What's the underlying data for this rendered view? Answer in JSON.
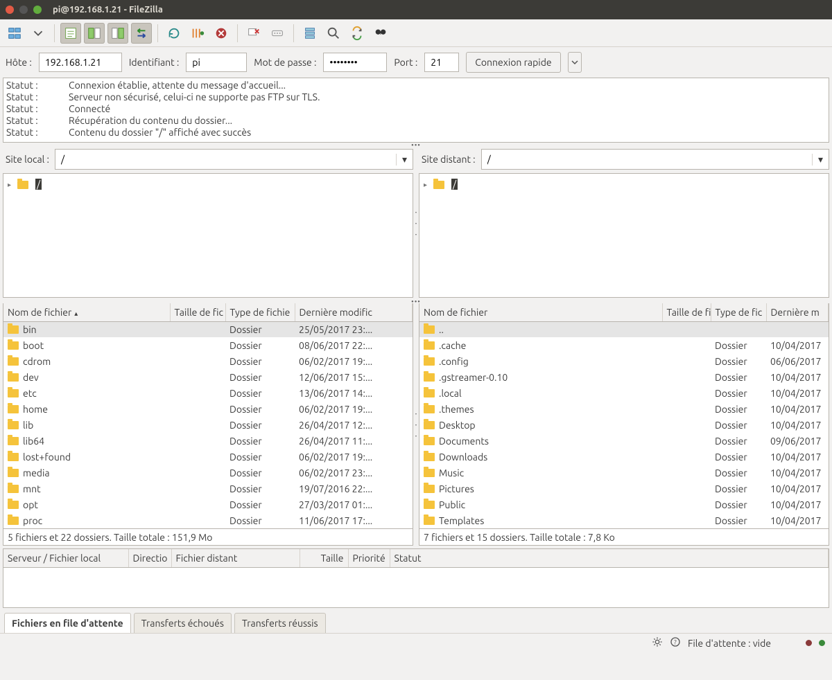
{
  "window": {
    "title": "pi@192.168.1.21 - FileZilla"
  },
  "quickconnect": {
    "host_label": "Hôte :",
    "host_value": "192.168.1.21",
    "user_label": "Identifiant :",
    "user_value": "pi",
    "pass_label": "Mot de passe :",
    "pass_value": "••••••••",
    "port_label": "Port :",
    "port_value": "21",
    "button": "Connexion rapide"
  },
  "log": [
    {
      "label": "Statut :",
      "msg": "Connexion établie, attente du message d'accueil..."
    },
    {
      "label": "Statut :",
      "msg": "Serveur non sécurisé, celui-ci ne supporte pas FTP sur TLS."
    },
    {
      "label": "Statut :",
      "msg": "Connecté"
    },
    {
      "label": "Statut :",
      "msg": "Récupération du contenu du dossier..."
    },
    {
      "label": "Statut :",
      "msg": "Contenu du dossier \"/\" affiché avec succès"
    }
  ],
  "local": {
    "label": "Site local :",
    "path": "/",
    "tree_root": "/",
    "columns": [
      "Nom de fichier",
      "Taille de fic",
      "Type de fichie",
      "Dernière modific"
    ],
    "rows": [
      {
        "name": "bin",
        "size": "",
        "type": "Dossier",
        "date": "25/05/2017 23:...",
        "selected": true
      },
      {
        "name": "boot",
        "size": "",
        "type": "Dossier",
        "date": "08/06/2017 22:..."
      },
      {
        "name": "cdrom",
        "size": "",
        "type": "Dossier",
        "date": "06/02/2017 19:..."
      },
      {
        "name": "dev",
        "size": "",
        "type": "Dossier",
        "date": "12/06/2017 15:..."
      },
      {
        "name": "etc",
        "size": "",
        "type": "Dossier",
        "date": "13/06/2017 14:..."
      },
      {
        "name": "home",
        "size": "",
        "type": "Dossier",
        "date": "06/02/2017 19:..."
      },
      {
        "name": "lib",
        "size": "",
        "type": "Dossier",
        "date": "26/04/2017 12:..."
      },
      {
        "name": "lib64",
        "size": "",
        "type": "Dossier",
        "date": "26/04/2017 11:..."
      },
      {
        "name": "lost+found",
        "size": "",
        "type": "Dossier",
        "date": "06/02/2017 19:..."
      },
      {
        "name": "media",
        "size": "",
        "type": "Dossier",
        "date": "06/02/2017 23:..."
      },
      {
        "name": "mnt",
        "size": "",
        "type": "Dossier",
        "date": "19/07/2016 22:..."
      },
      {
        "name": "opt",
        "size": "",
        "type": "Dossier",
        "date": "27/03/2017 01:..."
      },
      {
        "name": "proc",
        "size": "",
        "type": "Dossier",
        "date": "11/06/2017 17:..."
      }
    ],
    "status": "5 fichiers et 22 dossiers. Taille totale : 151,9 Mo"
  },
  "remote": {
    "label": "Site distant :",
    "path": "/",
    "tree_root": "/",
    "columns": [
      "Nom de fichier",
      "Taille de fi",
      "Type de fic",
      "Dernière m"
    ],
    "rows": [
      {
        "name": "..",
        "size": "",
        "type": "",
        "date": "",
        "selected": true
      },
      {
        "name": ".cache",
        "size": "",
        "type": "Dossier",
        "date": "10/04/2017"
      },
      {
        "name": ".config",
        "size": "",
        "type": "Dossier",
        "date": "06/06/2017"
      },
      {
        "name": ".gstreamer-0.10",
        "size": "",
        "type": "Dossier",
        "date": "10/04/2017"
      },
      {
        "name": ".local",
        "size": "",
        "type": "Dossier",
        "date": "10/04/2017"
      },
      {
        "name": ".themes",
        "size": "",
        "type": "Dossier",
        "date": "10/04/2017"
      },
      {
        "name": "Desktop",
        "size": "",
        "type": "Dossier",
        "date": "10/04/2017"
      },
      {
        "name": "Documents",
        "size": "",
        "type": "Dossier",
        "date": "09/06/2017"
      },
      {
        "name": "Downloads",
        "size": "",
        "type": "Dossier",
        "date": "10/04/2017"
      },
      {
        "name": "Music",
        "size": "",
        "type": "Dossier",
        "date": "10/04/2017"
      },
      {
        "name": "Pictures",
        "size": "",
        "type": "Dossier",
        "date": "10/04/2017"
      },
      {
        "name": "Public",
        "size": "",
        "type": "Dossier",
        "date": "10/04/2017"
      },
      {
        "name": "Templates",
        "size": "",
        "type": "Dossier",
        "date": "10/04/2017"
      }
    ],
    "status": "7 fichiers et 15 dossiers. Taille totale : 7,8 Ko"
  },
  "queue": {
    "columns": [
      "Serveur / Fichier local",
      "Directio",
      "Fichier distant",
      "Taille",
      "Priorité",
      "Statut"
    ]
  },
  "tabs": [
    "Fichiers en file d'attente",
    "Transferts échoués",
    "Transferts réussis"
  ],
  "statusbar": {
    "queue": "File d'attente : vide"
  }
}
